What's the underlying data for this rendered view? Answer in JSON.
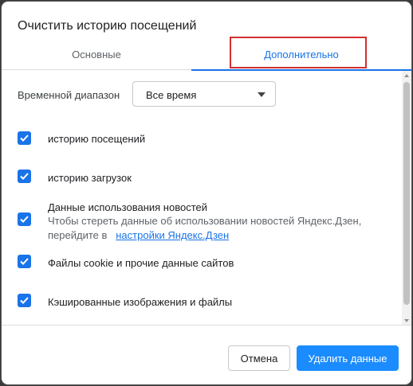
{
  "dialog": {
    "title": "Очистить историю посещений"
  },
  "tabs": [
    {
      "label": "Основные"
    },
    {
      "label": "Дополнительно"
    }
  ],
  "time_range": {
    "label": "Временной диапазон",
    "selected": "Все время"
  },
  "items": [
    {
      "label": "историю посещений",
      "checked": true
    },
    {
      "label": "историю загрузок",
      "checked": true
    },
    {
      "label": "Данные использования новостей",
      "sub_line1": "Чтобы стереть данные об использовании новостей Яндекс.Дзен,",
      "sub_line2": "перейдите в",
      "link": "настройки Яндекс.Дзен",
      "checked": true
    },
    {
      "label": "Файлы cookie и прочие данные сайтов",
      "checked": true
    },
    {
      "label": "Кэшированные изображения и файлы",
      "checked": true
    }
  ],
  "buttons": {
    "cancel": "Отмена",
    "delete": "Удалить данные"
  },
  "colors": {
    "accent": "#1a73e8",
    "highlight": "#d32f2f",
    "primary_button": "#1a8cff"
  }
}
